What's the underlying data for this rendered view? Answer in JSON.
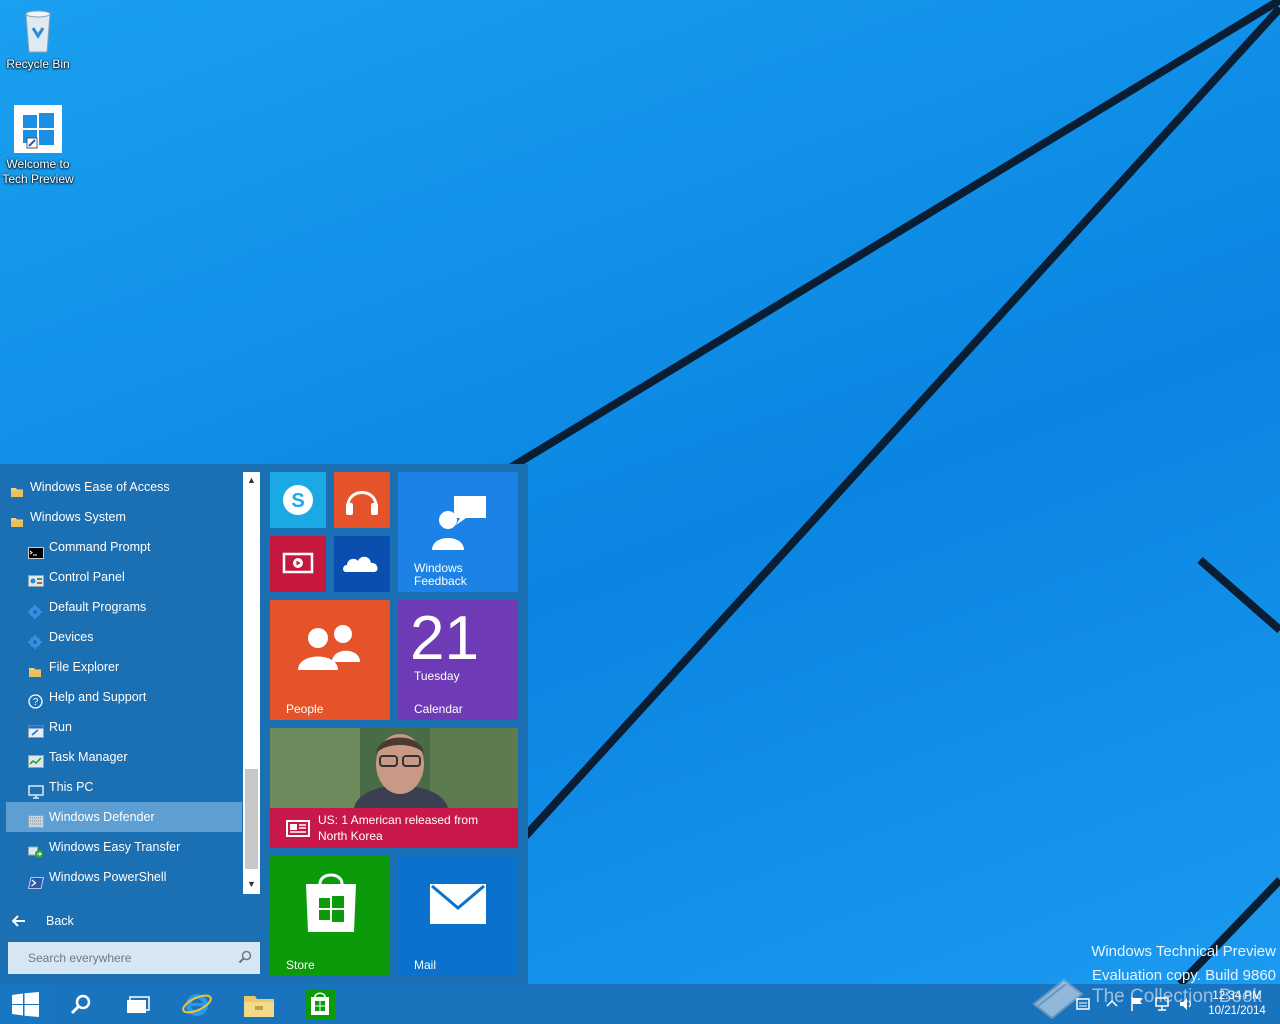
{
  "desktop": {
    "icons": [
      {
        "label": "Recycle Bin"
      },
      {
        "label1": "Welcome to",
        "label2": "Tech Preview"
      }
    ],
    "watermark": [
      "Windows Technical Preview",
      "Evaluation copy. Build 9860"
    ],
    "overlay_text": "The Collection Book",
    "colors": {
      "wallpaper": "#0a8ee6",
      "lines": "#0a1e33"
    }
  },
  "start_menu": {
    "apps": [
      {
        "label": "Windows Ease of Access",
        "icon": "folder-icon",
        "type": "folder"
      },
      {
        "label": "Windows System",
        "icon": "folder-icon",
        "type": "folder"
      },
      {
        "label": "Command Prompt",
        "icon": "console-icon"
      },
      {
        "label": "Control Panel",
        "icon": "control-panel-icon"
      },
      {
        "label": "Default Programs",
        "icon": "gear-icon"
      },
      {
        "label": "Devices",
        "icon": "gear-icon"
      },
      {
        "label": "File Explorer",
        "icon": "folder-icon"
      },
      {
        "label": "Help and Support",
        "icon": "help-icon"
      },
      {
        "label": "Run",
        "icon": "run-icon"
      },
      {
        "label": "Task Manager",
        "icon": "task-manager-icon"
      },
      {
        "label": "This PC",
        "icon": "computer-icon"
      },
      {
        "label": "Windows Defender",
        "icon": "defender-icon",
        "selected": true
      },
      {
        "label": "Windows Easy Transfer",
        "icon": "transfer-icon"
      },
      {
        "label": "Windows PowerShell",
        "icon": "powershell-icon"
      }
    ],
    "back_label": "Back",
    "search_placeholder": "Search everywhere",
    "tiles": {
      "feedback": "Windows Feedback",
      "people": "People",
      "calendar_day": "21",
      "calendar_weekday": "Tuesday",
      "calendar": "Calendar",
      "news": "US: 1 American released from North Korea",
      "store": "Store",
      "mail": "Mail"
    },
    "tile_colors": {
      "skype": "#1ba9e6",
      "music": "#e4532a",
      "video": "#c6183f",
      "onedrive": "#0a4fb0",
      "feedback": "#1d82e5",
      "people": "#e4532a",
      "calendar": "#6e3ab6",
      "news": "#c8184a",
      "store": "#0a9a0a",
      "mail": "#0a72cc"
    }
  },
  "taskbar": {
    "time": "12:34 PM",
    "date": "10/21/2014"
  }
}
